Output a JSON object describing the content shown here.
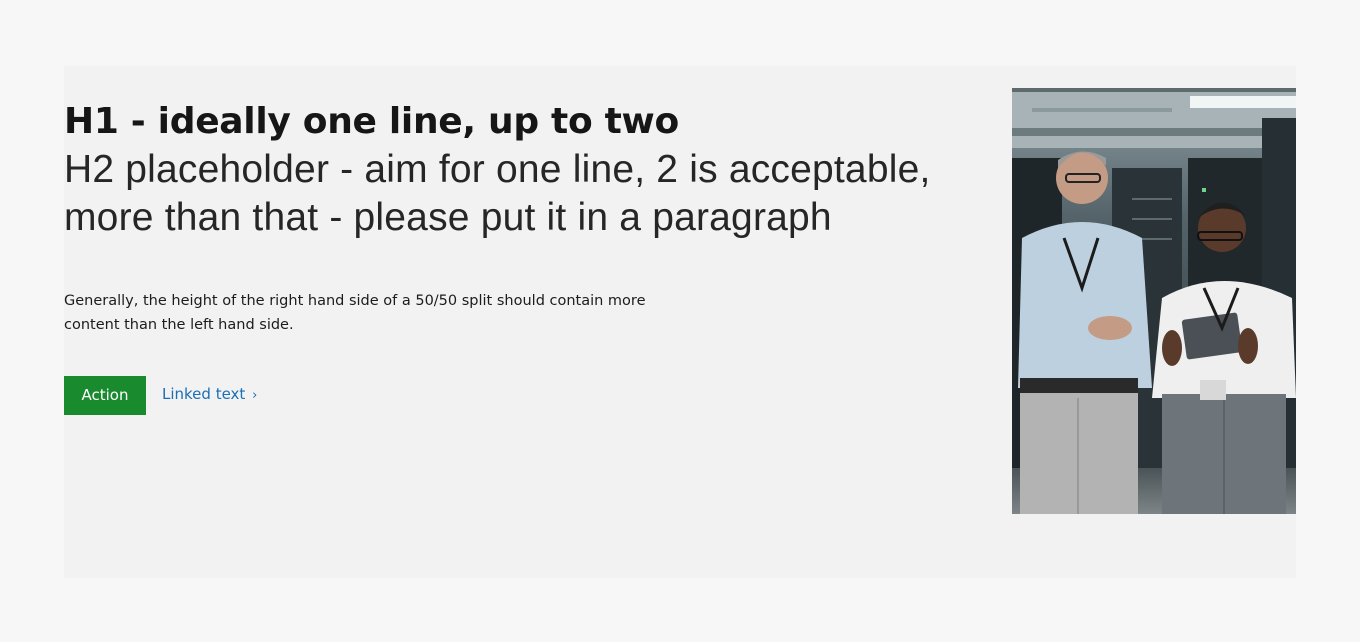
{
  "hero": {
    "h1": "H1 - ideally one line, up to two",
    "h2": "H2 placeholder - aim for one line, 2 is acceptable, more than that - please put it in a paragraph",
    "paragraph": "Generally, the height of the right hand side of a 50/50 split should contain more content than the left hand side.",
    "action_label": "Action",
    "link_label": "Linked text",
    "link_chevron": "›"
  },
  "image": {
    "subject": "photo-two-professionals-in-server-room-with-tablet"
  },
  "colors": {
    "page_background": "#f7f7f7",
    "section_background": "#f2f2f2",
    "action_button": "#198a2e",
    "link": "#1a6fb5"
  }
}
